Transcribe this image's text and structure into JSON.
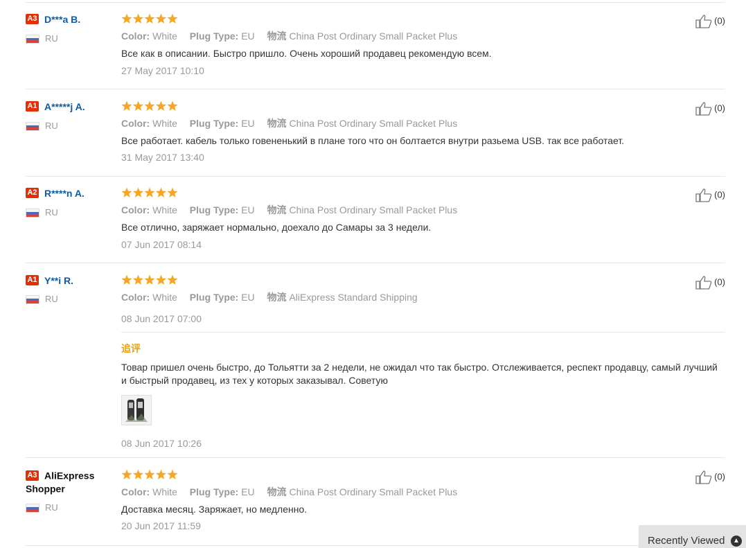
{
  "reviews": [
    {
      "level": "A3",
      "name": "D***a B.",
      "country": "RU",
      "color_label": "Color:",
      "color": "White",
      "plug_label": "Plug Type:",
      "plug": "EU",
      "ship_label": "物流",
      "shipping": "China Post Ordinary Small Packet Plus",
      "text": "Все как в описании. Быстро пришло. Очень хороший продавец рекомендую всем.",
      "date": "27 May 2017 10:10",
      "likes": "(0)",
      "rating": 5
    },
    {
      "level": "A1",
      "name": "A*****j A.",
      "country": "RU",
      "color_label": "Color:",
      "color": "White",
      "plug_label": "Plug Type:",
      "plug": "EU",
      "ship_label": "物流",
      "shipping": "China Post Ordinary Small Packet Plus",
      "text": "Все работает. кабель только говененький в плане того что он болтается внутри разьема USB. так все работает.",
      "date": "31 May 2017 13:40",
      "likes": "(0)",
      "rating": 5
    },
    {
      "level": "A2",
      "name": "R****n A.",
      "country": "RU",
      "color_label": "Color:",
      "color": "White",
      "plug_label": "Plug Type:",
      "plug": "EU",
      "ship_label": "物流",
      "shipping": "China Post Ordinary Small Packet Plus",
      "text": "Все отлично, заряжает нормально, доехало до Самары за 3 недели.",
      "date": "07 Jun 2017 08:14",
      "likes": "(0)",
      "rating": 5
    },
    {
      "level": "A1",
      "name": "Y**i R.",
      "country": "RU",
      "color_label": "Color:",
      "color": "White",
      "plug_label": "Plug Type:",
      "plug": "EU",
      "ship_label": "物流",
      "shipping": "AliExpress Standard Shipping",
      "date": "08 Jun 2017 07:00",
      "likes": "(0)",
      "rating": 5,
      "followup_label": "追评",
      "followup_text": "Товар пришел очень быстро, до Тольятти за 2 недели, не ожидал что так быстро. Отслеживается, респект продавцу, самый лучший и быстрый продавец, из тех у которых заказывал. Советую",
      "followup_date": "08 Jun 2017 10:26"
    },
    {
      "level": "A3",
      "name": "AliExpress Shopper",
      "country": "RU",
      "color_label": "Color:",
      "color": "White",
      "plug_label": "Plug Type:",
      "plug": "EU",
      "ship_label": "物流",
      "shipping": "China Post Ordinary Small Packet Plus",
      "text": "Доставка месяц. Заряжает, но медленно.",
      "date": "20 Jun 2017 11:59",
      "likes": "(0)",
      "rating": 5
    }
  ],
  "recently_viewed": {
    "label": "Recently Viewed",
    "icon": "chevron-up-icon"
  },
  "colors": {
    "level_badge": "#e62e04",
    "user_name": "#0e5ba8",
    "star": "#f5a623",
    "followup": "#e8a316"
  }
}
